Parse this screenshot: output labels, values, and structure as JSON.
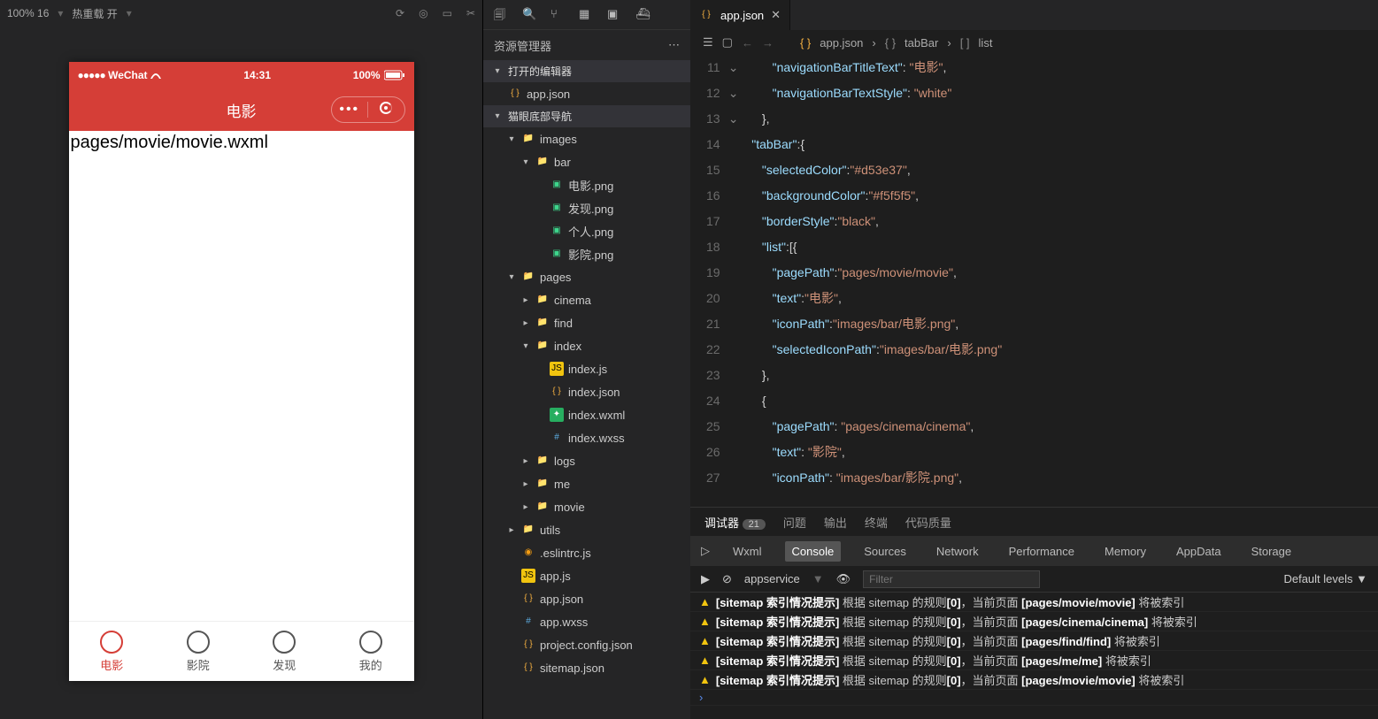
{
  "toolbar": {
    "zoom": "100% 16",
    "hot_reload": "热重载 开"
  },
  "simulator": {
    "carrier": "WeChat",
    "time": "14:31",
    "battery": "100%",
    "title": "电影",
    "page_text": "pages/movie/movie.wxml",
    "tabs": [
      {
        "label": "电影",
        "active": true
      },
      {
        "label": "影院"
      },
      {
        "label": "发现"
      },
      {
        "label": "我的"
      }
    ]
  },
  "explorer": {
    "title": "资源管理器",
    "open_editors": "打开的编辑器",
    "open_file": "app.json",
    "project": "猫眼底部导航",
    "tree": [
      {
        "d": 1,
        "c": "down",
        "t": "folder",
        "n": "images"
      },
      {
        "d": 2,
        "c": "down",
        "t": "folder",
        "n": "bar"
      },
      {
        "d": 3,
        "t": "img",
        "n": "电影.png"
      },
      {
        "d": 3,
        "t": "img",
        "n": "发现.png"
      },
      {
        "d": 3,
        "t": "img",
        "n": "个人.png"
      },
      {
        "d": 3,
        "t": "img",
        "n": "影院.png"
      },
      {
        "d": 1,
        "c": "down",
        "t": "folder",
        "n": "pages"
      },
      {
        "d": 2,
        "c": "right",
        "t": "folder",
        "n": "cinema"
      },
      {
        "d": 2,
        "c": "right",
        "t": "folder",
        "n": "find"
      },
      {
        "d": 2,
        "c": "down",
        "t": "folder",
        "n": "index"
      },
      {
        "d": 3,
        "t": "js",
        "n": "index.js"
      },
      {
        "d": 3,
        "t": "json",
        "n": "index.json"
      },
      {
        "d": 3,
        "t": "wxml",
        "n": "index.wxml"
      },
      {
        "d": 3,
        "t": "wxss",
        "n": "index.wxss"
      },
      {
        "d": 2,
        "c": "right",
        "t": "folder",
        "n": "logs"
      },
      {
        "d": 2,
        "c": "right",
        "t": "folder",
        "n": "me"
      },
      {
        "d": 2,
        "c": "right",
        "t": "folder",
        "n": "movie"
      },
      {
        "d": 1,
        "c": "right",
        "t": "folder",
        "n": "utils"
      },
      {
        "d": 1,
        "t": "js2",
        "n": ".eslintrc.js"
      },
      {
        "d": 1,
        "t": "js",
        "n": "app.js"
      },
      {
        "d": 1,
        "t": "json",
        "n": "app.json"
      },
      {
        "d": 1,
        "t": "wxss",
        "n": "app.wxss"
      },
      {
        "d": 1,
        "t": "json",
        "n": "project.config.json"
      },
      {
        "d": 1,
        "t": "json",
        "n": "sitemap.json"
      }
    ]
  },
  "editor": {
    "tab_name": "app.json",
    "breadcrumb": [
      "app.json",
      "tabBar",
      "list"
    ],
    "lines": [
      {
        "n": 11,
        "ind": 3,
        "tok": [
          [
            "key",
            "\"navigationBarTitleText\""
          ],
          [
            "punc",
            ": "
          ],
          [
            "str",
            "\"电影\""
          ],
          [
            "punc",
            ","
          ]
        ]
      },
      {
        "n": 12,
        "ind": 3,
        "tok": [
          [
            "key",
            "\"navigationBarTextStyle\""
          ],
          [
            "punc",
            ": "
          ],
          [
            "str",
            "\"white\""
          ]
        ]
      },
      {
        "n": 13,
        "ind": 2,
        "tok": [
          [
            "brace",
            "}"
          ],
          [
            "punc",
            ","
          ]
        ]
      },
      {
        "n": 14,
        "ind": 1,
        "fold": "down",
        "tok": [
          [
            "key",
            "\"tabBar\""
          ],
          [
            "punc",
            ":"
          ],
          [
            "brace",
            "{"
          ]
        ]
      },
      {
        "n": 15,
        "ind": 2,
        "tok": [
          [
            "key",
            "\"selectedColor\""
          ],
          [
            "punc",
            ":"
          ],
          [
            "str",
            "\"#d53e37\""
          ],
          [
            "punc",
            ","
          ]
        ]
      },
      {
        "n": 16,
        "ind": 2,
        "tok": [
          [
            "key",
            "\"backgroundColor\""
          ],
          [
            "punc",
            ":"
          ],
          [
            "str",
            "\"#f5f5f5\""
          ],
          [
            "punc",
            ","
          ]
        ]
      },
      {
        "n": 17,
        "ind": 2,
        "tok": [
          [
            "key",
            "\"borderStyle\""
          ],
          [
            "punc",
            ":"
          ],
          [
            "str",
            "\"black\""
          ],
          [
            "punc",
            ","
          ]
        ]
      },
      {
        "n": 18,
        "ind": 2,
        "fold": "down",
        "tok": [
          [
            "key",
            "\"list\""
          ],
          [
            "punc",
            ":["
          ],
          [
            "brace",
            "{"
          ]
        ]
      },
      {
        "n": 19,
        "ind": 3,
        "tok": [
          [
            "key",
            "\"pagePath\""
          ],
          [
            "punc",
            ":"
          ],
          [
            "str",
            "\"pages/movie/movie\""
          ],
          [
            "punc",
            ","
          ]
        ]
      },
      {
        "n": 20,
        "ind": 3,
        "tok": [
          [
            "key",
            "\"text\""
          ],
          [
            "punc",
            ":"
          ],
          [
            "str",
            "\"电影\""
          ],
          [
            "punc",
            ","
          ]
        ]
      },
      {
        "n": 21,
        "ind": 3,
        "tok": [
          [
            "key",
            "\"iconPath\""
          ],
          [
            "punc",
            ":"
          ],
          [
            "str",
            "\"images/bar/电影.png\""
          ],
          [
            "punc",
            ","
          ]
        ]
      },
      {
        "n": 22,
        "ind": 3,
        "tok": [
          [
            "key",
            "\"selectedIconPath\""
          ],
          [
            "punc",
            ":"
          ],
          [
            "str",
            "\"images/bar/电影.png\""
          ]
        ]
      },
      {
        "n": 23,
        "ind": 2,
        "tok": [
          [
            "brace",
            "}"
          ],
          [
            "punc",
            ","
          ]
        ]
      },
      {
        "n": 24,
        "ind": 2,
        "fold": "down",
        "tok": [
          [
            "brace",
            "{"
          ]
        ]
      },
      {
        "n": 25,
        "ind": 3,
        "tok": [
          [
            "key",
            "\"pagePath\""
          ],
          [
            "punc",
            ": "
          ],
          [
            "str",
            "\"pages/cinema/cinema\""
          ],
          [
            "punc",
            ","
          ]
        ]
      },
      {
        "n": 26,
        "ind": 3,
        "tok": [
          [
            "key",
            "\"text\""
          ],
          [
            "punc",
            ": "
          ],
          [
            "str",
            "\"影院\""
          ],
          [
            "punc",
            ","
          ]
        ]
      },
      {
        "n": 27,
        "ind": 3,
        "tok": [
          [
            "key",
            "\"iconPath\""
          ],
          [
            "punc",
            ": "
          ],
          [
            "str",
            "\"images/bar/影院.png\""
          ],
          [
            "punc",
            ","
          ]
        ]
      }
    ]
  },
  "bottom": {
    "tabs": [
      {
        "n": "调试器",
        "badge": "21",
        "active": true
      },
      {
        "n": "问题"
      },
      {
        "n": "输出"
      },
      {
        "n": "终端"
      },
      {
        "n": "代码质量"
      }
    ],
    "devtool": [
      "Wxml",
      "Console",
      "Sources",
      "Network",
      "Performance",
      "Memory",
      "AppData",
      "Storage"
    ],
    "devtool_active": "Console",
    "ctx": "appservice",
    "filter_ph": "Filter",
    "levels": "Default levels",
    "logs": [
      "[sitemap 索引情况提示] 根据 sitemap 的规则[0]，当前页面 [pages/movie/movie] 将被索引",
      "[sitemap 索引情况提示] 根据 sitemap 的规则[0]，当前页面 [pages/cinema/cinema] 将被索引",
      "[sitemap 索引情况提示] 根据 sitemap 的规则[0]，当前页面 [pages/find/find] 将被索引",
      "[sitemap 索引情况提示] 根据 sitemap 的规则[0]，当前页面 [pages/me/me] 将被索引",
      "[sitemap 索引情况提示] 根据 sitemap 的规则[0]，当前页面 [pages/movie/movie] 将被索引"
    ]
  }
}
